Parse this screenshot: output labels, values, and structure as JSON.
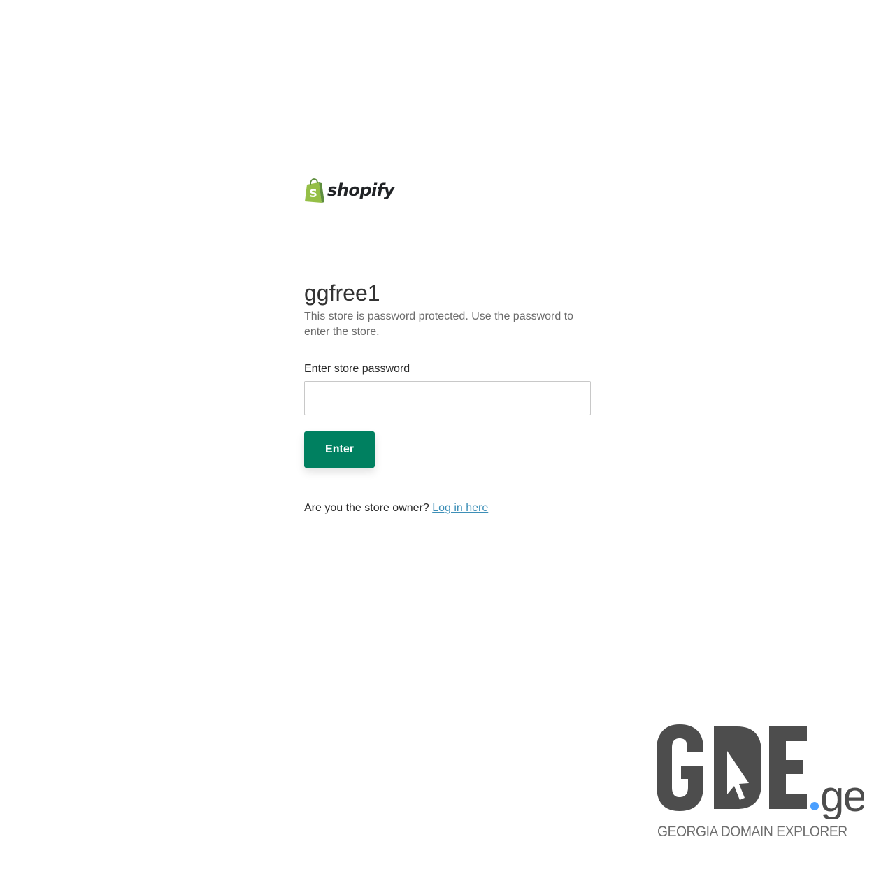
{
  "brand": {
    "wordmark": "shopify",
    "bag_color": "#95bf47",
    "bag_shadow_color": "#5e8e3e"
  },
  "store": {
    "name": "ggfree1",
    "description": "This store is password protected. Use the password to enter the store."
  },
  "password_form": {
    "label": "Enter store password",
    "value": "",
    "placeholder": "",
    "submit_label": "Enter",
    "submit_color": "#008060"
  },
  "owner": {
    "prompt": "Are you the store owner?",
    "link_text": "Log in here",
    "link_color": "#3d8fb7"
  },
  "watermark": {
    "letters": "GDE",
    "dot_color": "#4a9fff",
    "suffix": "ge",
    "caption": "GEORGIA DOMAIN EXPLORER",
    "icon": "cursor-arrow-icon"
  }
}
